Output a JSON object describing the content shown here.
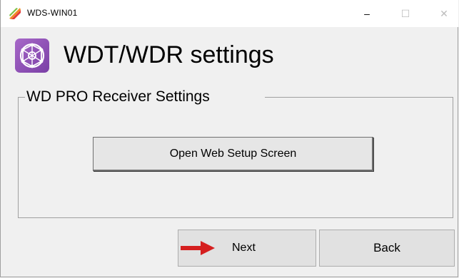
{
  "window": {
    "title": "WDS-WIN01",
    "controls": {
      "minimize": "–",
      "maximize": "☐",
      "close": "✕"
    }
  },
  "header": {
    "title": "WDT/WDR settings",
    "icon": "network-globe-icon"
  },
  "group": {
    "label": "WD PRO Receiver Settings",
    "open_web_button": "Open Web Setup Screen"
  },
  "footer": {
    "next_label": "Next",
    "back_label": "Back",
    "pointer_icon": "red-arrow-icon"
  },
  "colors": {
    "accent_purple": "#8e4fb8",
    "arrow_red": "#d51f1f"
  }
}
